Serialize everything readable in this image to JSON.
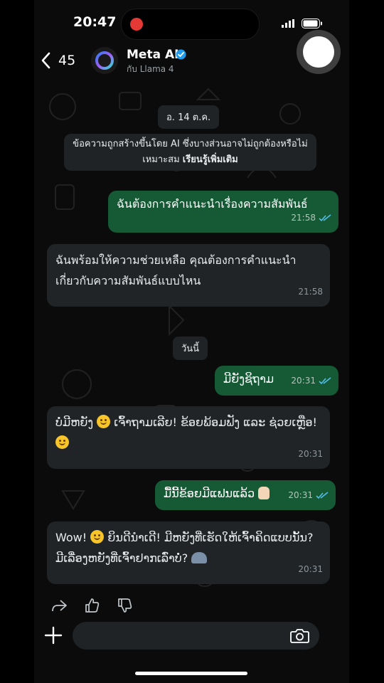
{
  "status_bar": {
    "time": "20:47"
  },
  "header": {
    "back_count": "45",
    "contact_name": "Meta AI",
    "contact_subtitle": "กับ Llama 4"
  },
  "chat": {
    "date_chip_1": "อ. 14 ต.ค.",
    "notice": {
      "text": "ข้อความถูกสร้างขึ้นโดย AI ซึ่งบางส่วนอาจไม่ถูกต้องหรือไม่เหมาะสม",
      "link": "เรียนรู้เพิ่มเติม"
    },
    "date_chip_2": "วันนี้",
    "messages": [
      {
        "direction": "out",
        "text": "ฉันต้องการคำแนะนำเรื่องความสัมพันธ์",
        "time": "21:58",
        "read": true
      },
      {
        "direction": "in",
        "text": "ฉันพร้อมให้ความช่วยเหลือ คุณต้องการคำแนะนำเกี่ยวกับความสัมพันธ์แบบไหน",
        "time": "21:58"
      },
      {
        "direction": "out",
        "text": "ມີຍັງຊິຖາມ",
        "time": "20:31",
        "read": true
      },
      {
        "direction": "in",
        "text_a": "ບໍ່ມີຫຍັງ",
        "text_b": "ເຈົ້າຖາມເລີຍ! ຂ້ອຍພ້ອມຟັງ ແລະ ຊ່ວຍເຫຼືອ!",
        "time": "20:31"
      },
      {
        "direction": "out",
        "text": "ມື້ນີ້ຂ້ອຍມີແຟນແລ້ວ",
        "time": "20:31",
        "read": true
      },
      {
        "direction": "in",
        "text_a": "Wow!",
        "text_b": "ຍິນດີນຳເດີ! ມີຫຍັງທີ່ເຮັດໃຫ້ເຈົ້າຄິດແບບນັ້ນ? ມີເລື່ອງຫຍັງທີ່ເຈົ້າຢາກເລົ່າບໍ່?",
        "time": "20:31"
      }
    ]
  },
  "icons": [
    "back-chevron-icon",
    "verified-badge-icon",
    "forward-icon",
    "thumbs-up-icon",
    "thumbs-down-icon",
    "plus-icon",
    "camera-icon"
  ],
  "colors": {
    "outgoing_bubble": "#155a35",
    "incoming_bubble": "#202427",
    "read_ticks": "#53bdeb",
    "verified": "#1d9bf0"
  }
}
